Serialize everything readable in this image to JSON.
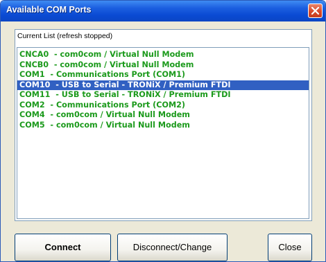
{
  "window": {
    "title": "Available COM Ports",
    "accent_color": "#0a4ad3",
    "close_icon": "close-x-icon"
  },
  "panel": {
    "label": "Current List (refresh stopped)"
  },
  "ports": [
    {
      "text": "CNCA0  - com0com / Virtual Null Modem",
      "selected": false
    },
    {
      "text": "CNCB0  - com0com / Virtual Null Modem",
      "selected": false
    },
    {
      "text": "COM1  - Communications Port (COM1)",
      "selected": false
    },
    {
      "text": "COM10  - USB to Serial - TRONiX / Premium FTDI",
      "selected": true
    },
    {
      "text": "COM11  - USB to Serial - TRONiX / Premium FTDI",
      "selected": false
    },
    {
      "text": "COM2  - Communications Port (COM2)",
      "selected": false
    },
    {
      "text": "COM4  - com0com / Virtual Null Modem",
      "selected": false
    },
    {
      "text": "COM5  - com0com / Virtual Null Modem",
      "selected": false
    }
  ],
  "list_colors": {
    "text": "#1c9a1c",
    "selected_background": "#3160c2",
    "selected_text": "#ffffff"
  },
  "buttons": {
    "connect": "Connect",
    "disconnect": "Disconnect/Change",
    "close": "Close"
  }
}
